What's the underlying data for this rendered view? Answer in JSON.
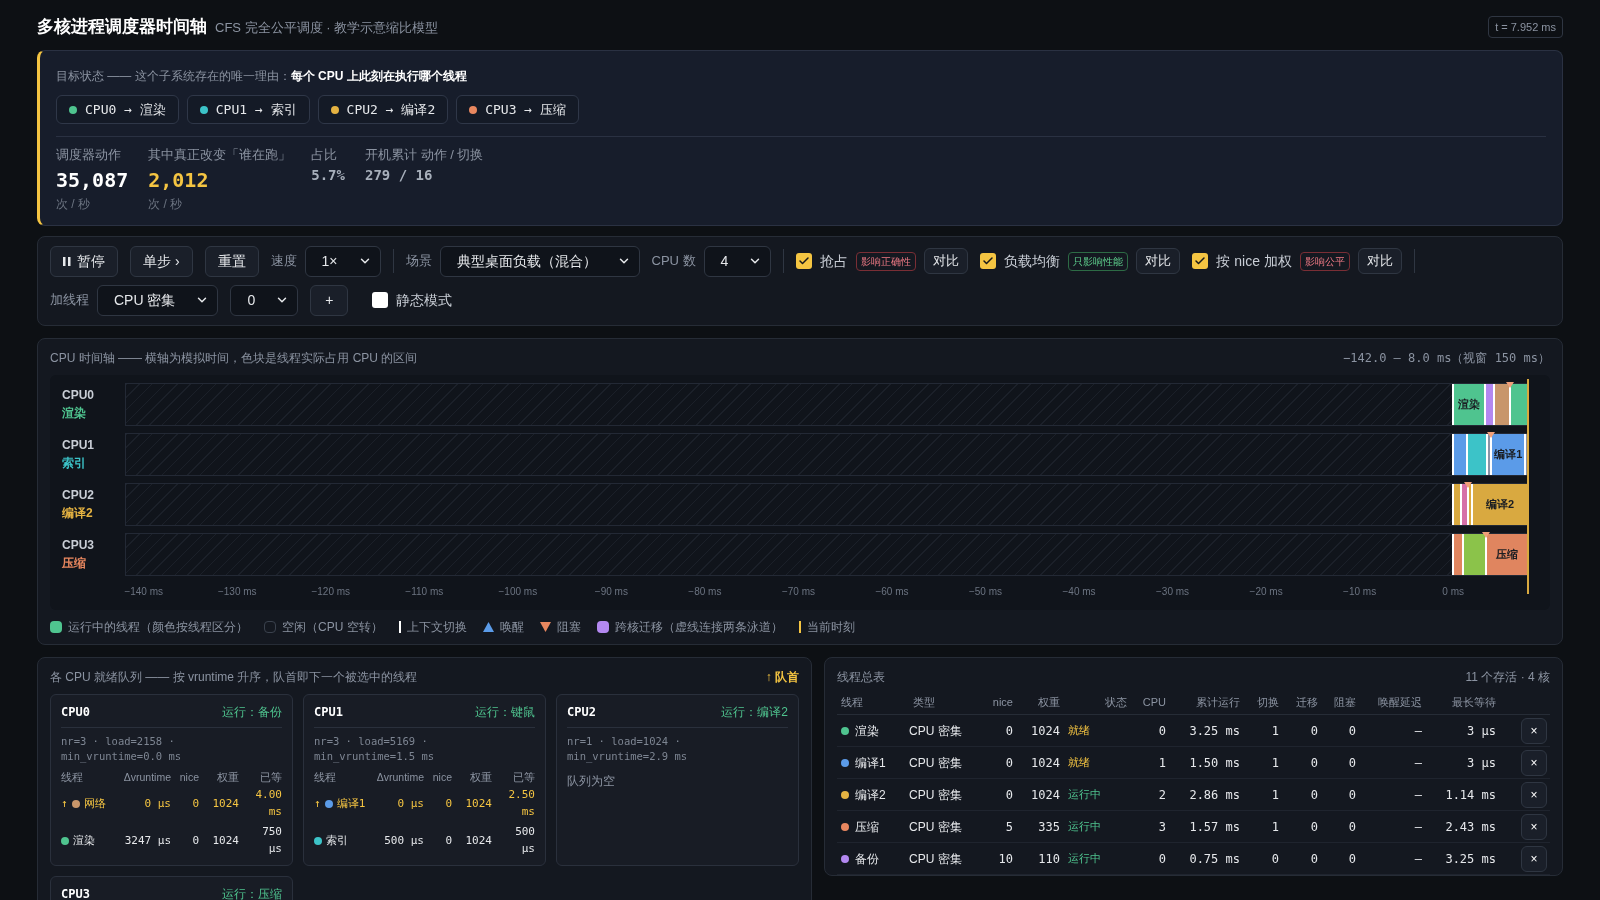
{
  "header": {
    "title": "多核进程调度器时间轴",
    "subtitle": "CFS 完全公平调度 · 教学示意缩比模型",
    "clock": "t = 7.952 ms"
  },
  "goal": {
    "text": "目标状态 —— 这个子系统存在的唯一理由：**每个 CPU 上此刻在执行哪个线程**",
    "assignments": [
      {
        "label": "CPU0 → 渲染",
        "color": "#4fc48f"
      },
      {
        "label": "CPU1 → 索引",
        "color": "#3cc3c8"
      },
      {
        "label": "CPU2 → 编译2",
        "color": "#e5b342"
      },
      {
        "label": "CPU3 → 压缩",
        "color": "#e8875f"
      }
    ],
    "stats": [
      {
        "label": "调度器动作",
        "value": "35,087",
        "unit": "次 / 秒",
        "kind": "primary"
      },
      {
        "label": "其中真正改变「谁在跑」",
        "value": "2,012",
        "unit": "次 / 秒",
        "kind": "highlight"
      },
      {
        "label": "占比",
        "value": "5.7%",
        "kind": "secondary"
      },
      {
        "label": "开机累计 动作 / 切换",
        "value": "279 / 16",
        "kind": "secondary"
      }
    ]
  },
  "toolbar": {
    "rows": [
      [
        [
          {
            "kind": "pause",
            "label": "暂停"
          },
          {
            "kind": "button",
            "label": "单步 ›"
          },
          {
            "kind": "button",
            "label": "重置"
          },
          {
            "kind": "select",
            "label": "速度",
            "value": "1×"
          }
        ],
        [
          {
            "kind": "select",
            "label": "场景",
            "value": "典型桌面负载（混合）"
          },
          {
            "kind": "select",
            "label": "CPU 数",
            "value": "4"
          }
        ],
        [
          {
            "kind": "toggle",
            "label": "抢占",
            "checked": true,
            "tag": {
              "text": "影响正确性",
              "kind": "danger"
            },
            "action": "对比"
          },
          {
            "kind": "toggle",
            "label": "负载均衡",
            "checked": true,
            "tag": {
              "text": "只影响性能",
              "kind": "safe"
            },
            "action": "对比"
          },
          {
            "kind": "toggle",
            "label": "按 nice 加权",
            "checked": true,
            "tag": {
              "text": "影响公平",
              "kind": "danger"
            },
            "action": "对比"
          }
        ]
      ],
      [
        [
          {
            "kind": "select",
            "label": "加线程",
            "value": "CPU 密集"
          },
          {
            "kind": "select",
            "value": "0"
          },
          {
            "kind": "button",
            "label": "+"
          },
          {
            "kind": "check",
            "label": "静态模式",
            "checked": false
          }
        ]
      ]
    ]
  },
  "timeline": {
    "title": "CPU 时间轴 —— 横轴为模拟时间，色块是线程实际占用 CPU 的区间",
    "range": "−142.0 – 8.0 ms（视窗 150 ms）",
    "lanes": [
      {
        "cpu": "CPU0",
        "thread": "渲染",
        "color": "#4fc48f",
        "segments": [
          {
            "color": "#4fc48f",
            "label": "渲染",
            "blocked": false
          },
          {
            "color": "#b388f0",
            "blocked": false
          },
          {
            "color": "#c8966b",
            "blocked": false
          },
          {
            "color": "#4fc48f",
            "blocked": true
          }
        ]
      },
      {
        "cpu": "CPU1",
        "thread": "索引",
        "color": "#3cc3c8",
        "segments": [
          {
            "color": "#5b9be8",
            "blocked": false
          },
          {
            "color": "#3cc3c8",
            "blocked": false
          },
          {
            "color": "#8a94a6",
            "blocked": false
          },
          {
            "color": "#5b9be8",
            "label": "编译1",
            "blocked": true
          },
          {
            "color": "#8a94a6",
            "blocked": false
          }
        ]
      },
      {
        "cpu": "CPU2",
        "thread": "编译2",
        "color": "#e5b342",
        "segments": [
          {
            "color": "#d9a940",
            "blocked": false
          },
          {
            "color": "#d66fa8",
            "blocked": false
          },
          {
            "color": "#d9a940",
            "blocked": true
          },
          {
            "color": "#d9a940",
            "label": "编译2",
            "blocked": false
          }
        ]
      },
      {
        "cpu": "CPU3",
        "thread": "压缩",
        "color": "#e8875f",
        "segments": [
          {
            "color": "#e0855f",
            "blocked": false
          },
          {
            "color": "#8bc34a",
            "blocked": false
          },
          {
            "color": "#e0855f",
            "label": "压缩",
            "blocked": true
          }
        ]
      }
    ],
    "ticks": [
      "−140 ms",
      "−130 ms",
      "−120 ms",
      "−110 ms",
      "−100 ms",
      "−90 ms",
      "−80 ms",
      "−70 ms",
      "−60 ms",
      "−50 ms",
      "−40 ms",
      "−30 ms",
      "−20 ms",
      "−10 ms",
      "0 ms"
    ],
    "legend": [
      {
        "kind": "run",
        "label": "运行中的线程（颜色按线程区分）"
      },
      {
        "kind": "idle",
        "label": "空闲（CPU 空转）"
      },
      {
        "kind": "switch",
        "label": "上下文切换"
      },
      {
        "kind": "wake",
        "label": "唤醒"
      },
      {
        "kind": "block",
        "label": "阻塞"
      },
      {
        "kind": "migrate",
        "label": "跨核迁移（虚线连接两条泳道）"
      },
      {
        "kind": "now",
        "label": "当前时刻"
      }
    ]
  },
  "queues": {
    "title": "各 CPU 就绪队列 —— 按 vruntime 升序，队首即下一个被选中的线程",
    "head_legend": "↑ 队首",
    "head_symbol": "↑",
    "cpus": [
      {
        "name": "CPU0",
        "running": "运行：备份",
        "stats": "nr=3 · load=2158 · min_vruntime=0.0 ms",
        "columns": [
          "线程",
          "Δvruntime",
          "nice",
          "权重",
          "已等"
        ],
        "rows": [
          {
            "head": true,
            "color": "#c8966b",
            "thread": "网络",
            "dv": "0 µs",
            "nice": "0",
            "weight": "1024",
            "waited": "4.00 ms"
          },
          {
            "head": false,
            "color": "#4fc48f",
            "thread": "渲染",
            "dv": "3247 µs",
            "nice": "0",
            "weight": "1024",
            "waited": "750 µs"
          }
        ]
      },
      {
        "name": "CPU1",
        "running": "运行：键鼠",
        "stats": "nr=3 · load=5169 · min_vruntime=1.5 ms",
        "columns": [
          "线程",
          "Δvruntime",
          "nice",
          "权重",
          "已等"
        ],
        "rows": [
          {
            "head": true,
            "color": "#5b9be8",
            "thread": "编译1",
            "dv": "0 µs",
            "nice": "0",
            "weight": "1024",
            "waited": "2.50 ms"
          },
          {
            "head": false,
            "color": "#3cc3c8",
            "thread": "索引",
            "dv": "500 µs",
            "nice": "0",
            "weight": "1024",
            "waited": "500 µs"
          }
        ]
      },
      {
        "name": "CPU2",
        "running": "运行：编译2",
        "stats": "nr=1 · load=1024 · min_vruntime=2.9 ms",
        "empty": "队列为空"
      },
      {
        "name": "CPU3",
        "running": "运行：压缩"
      }
    ]
  },
  "threads": {
    "title": "线程总表",
    "summary": "11 个存活 · 4 核",
    "columns": [
      "线程",
      "类型",
      "nice",
      "权重",
      "状态",
      "CPU",
      "累计运行",
      "切换",
      "迁移",
      "阻塞",
      "唤醒延迟",
      "最长等待"
    ],
    "rows": [
      {
        "color": "#4fc48f",
        "name": "渲染",
        "type": "CPU 密集",
        "nice": "0",
        "weight": "1024",
        "state": {
          "text": "就绪",
          "kind": "ready"
        },
        "cpu": "0",
        "runtime": "3.25 ms",
        "switches": "1",
        "migrations": "0",
        "blocks": "0",
        "wake_latency": "—",
        "max_wait": "3 µs",
        "remove": "×"
      },
      {
        "color": "#5b9be8",
        "name": "编译1",
        "type": "CPU 密集",
        "nice": "0",
        "weight": "1024",
        "state": {
          "text": "就绪",
          "kind": "ready"
        },
        "cpu": "1",
        "runtime": "1.50 ms",
        "switches": "1",
        "migrations": "0",
        "blocks": "0",
        "wake_latency": "—",
        "max_wait": "3 µs",
        "remove": "×"
      },
      {
        "color": "#e5b342",
        "name": "编译2",
        "type": "CPU 密集",
        "nice": "0",
        "weight": "1024",
        "state": {
          "text": "运行中",
          "kind": "running"
        },
        "cpu": "2",
        "runtime": "2.86 ms",
        "switches": "1",
        "migrations": "0",
        "blocks": "0",
        "wake_latency": "—",
        "max_wait": "1.14 ms",
        "remove": "×"
      },
      {
        "color": "#e8875f",
        "name": "压缩",
        "type": "CPU 密集",
        "nice": "5",
        "weight": "335",
        "state": {
          "text": "运行中",
          "kind": "running"
        },
        "cpu": "3",
        "runtime": "1.57 ms",
        "switches": "1",
        "migrations": "0",
        "blocks": "0",
        "wake_latency": "—",
        "max_wait": "2.43 ms",
        "remove": "×"
      },
      {
        "color": "#b388f0",
        "name": "备份",
        "type": "CPU 密集",
        "nice": "10",
        "weight": "110",
        "state": {
          "text": "运行中",
          "kind": "running"
        },
        "cpu": "0",
        "runtime": "0.75 ms",
        "switches": "0",
        "migrations": "0",
        "blocks": "0",
        "wake_latency": "—",
        "max_wait": "3.25 ms",
        "remove": "×"
      }
    ]
  }
}
